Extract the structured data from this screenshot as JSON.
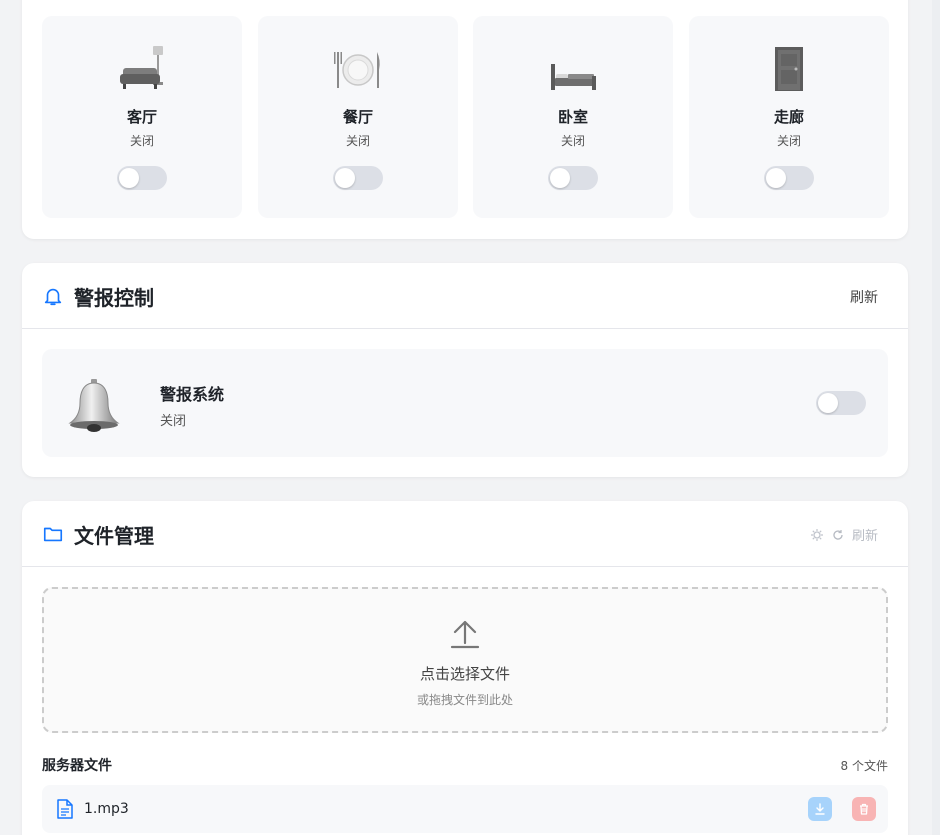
{
  "rooms": [
    {
      "name": "客厅",
      "state": "关闭",
      "icon": "sofa-lamp-icon"
    },
    {
      "name": "餐厅",
      "state": "关闭",
      "icon": "plate-cutlery-icon"
    },
    {
      "name": "卧室",
      "state": "关闭",
      "icon": "bed-icon"
    },
    {
      "name": "走廊",
      "state": "关闭",
      "icon": "door-icon"
    }
  ],
  "alarm": {
    "title": "警报控制",
    "refresh": "刷新",
    "system_name": "警报系统",
    "system_state": "关闭",
    "enabled": false
  },
  "files": {
    "title": "文件管理",
    "refresh": "刷新",
    "upload_title": "点击选择文件",
    "upload_sub": "或拖拽文件到此处",
    "list_title": "服务器文件",
    "count": "8 个文件",
    "items": [
      {
        "name": "1.mp3"
      }
    ]
  },
  "colors": {
    "accent": "#1677ff",
    "toggle_off": "#dcdfe6",
    "download_btn": "#a7d3fb",
    "delete_btn": "#f8b4b4"
  }
}
